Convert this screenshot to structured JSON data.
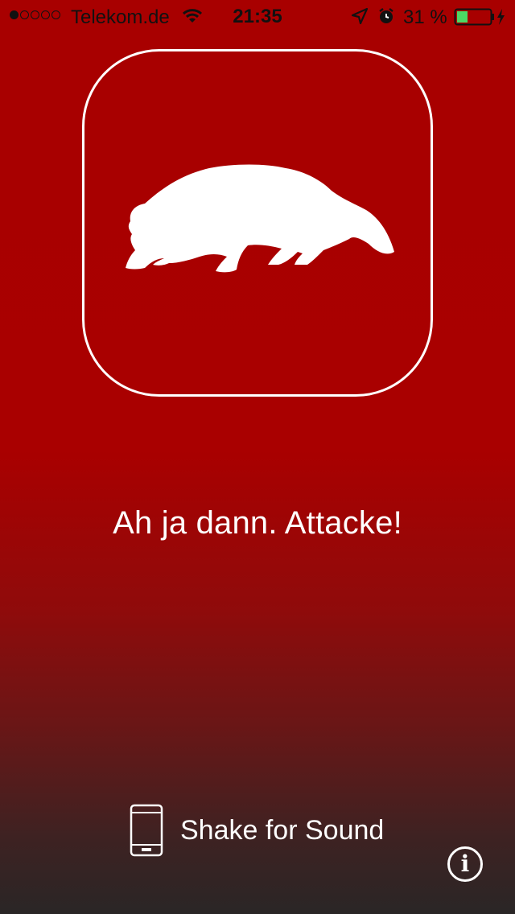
{
  "status_bar": {
    "signal_bars_filled": 1,
    "signal_bars_total": 5,
    "carrier": "Telekom.de",
    "time": "21:35",
    "battery_percent": "31 %",
    "battery_level": 0.31,
    "icons": [
      "wifi-icon",
      "location-arrow-icon",
      "alarm-clock-icon",
      "battery-icon",
      "charging-bolt-icon"
    ]
  },
  "app_icon": {
    "icon": "badger-icon"
  },
  "main": {
    "tagline": "Ah ja dann. Attacke!"
  },
  "shake": {
    "icon": "phone-icon",
    "label": "Shake for Sound"
  },
  "info": {
    "icon": "info-icon",
    "glyph": "i"
  },
  "colors": {
    "background_top": "#a80000",
    "background_bottom": "#2a2626",
    "foreground": "#ffffff",
    "battery_fill": "#4cd964"
  }
}
